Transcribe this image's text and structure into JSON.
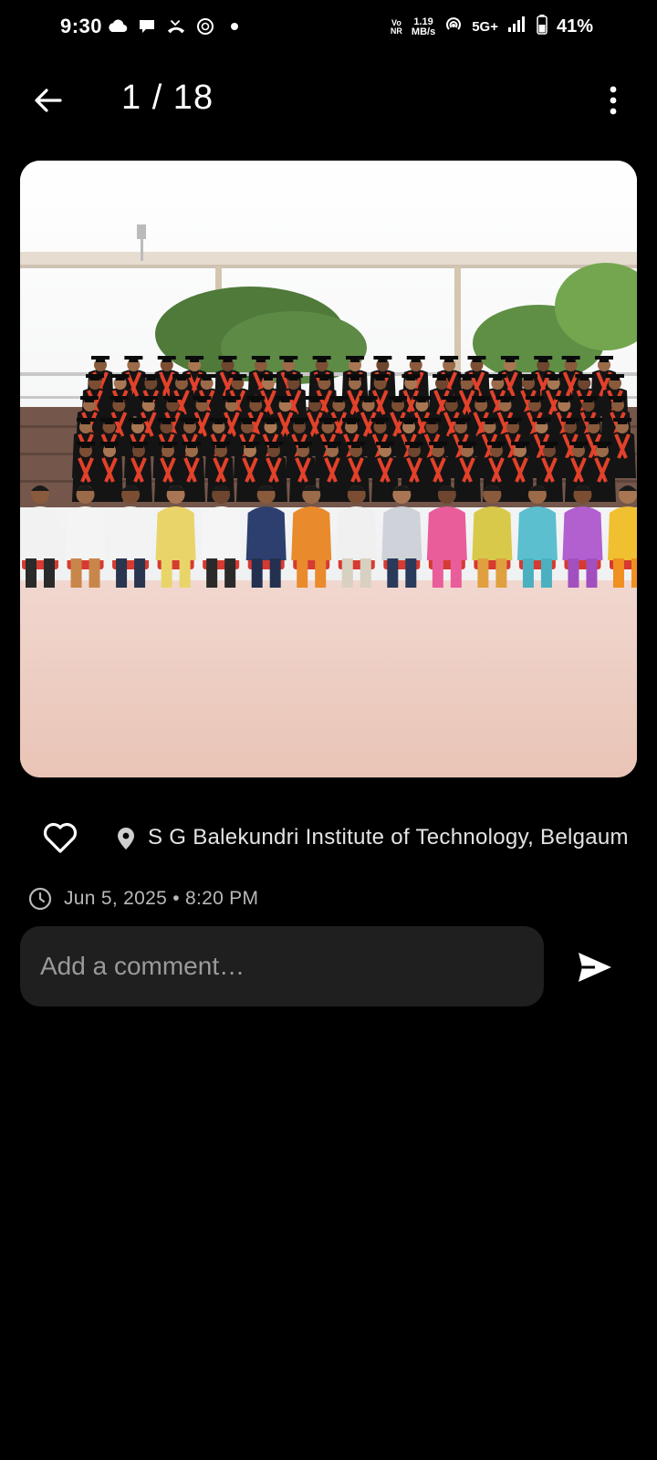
{
  "status_bar": {
    "time": "9:30",
    "notification_icons": [
      "cloud-icon",
      "chat-bubble-icon",
      "missed-call-icon",
      "openai-icon",
      "dot-icon"
    ],
    "volte_line1": "Vo",
    "volte_line2": "NR",
    "speed_value": "1.19",
    "speed_unit": "MB/s",
    "network": "5G+",
    "battery": "41%"
  },
  "header": {
    "counter": "1 / 18"
  },
  "photo": {
    "subject": "graduation-group-photo"
  },
  "info": {
    "location": "S G Balekundri Institute of Technology, Belgaum",
    "datetime": "Jun 5, 2025 • 8:20 PM"
  },
  "comment": {
    "placeholder": "Add a comment…"
  },
  "colors": {
    "background": "#000000",
    "input_bg": "#1f1f1f",
    "text_primary": "#ffffff",
    "text_secondary": "#b8b8b8",
    "sash_red": "#e2412a"
  }
}
